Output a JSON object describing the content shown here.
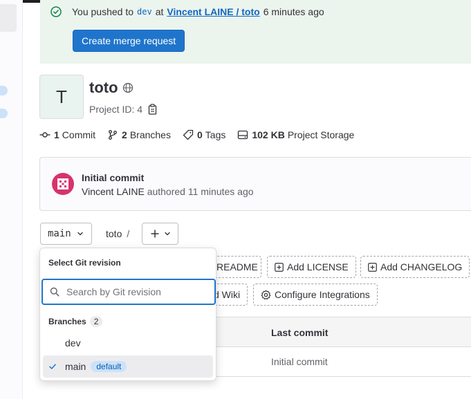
{
  "banner": {
    "text_before": "You pushed to",
    "branch": "dev",
    "text_at": "at",
    "project_link": "Vincent LAINE / toto",
    "time": "6 minutes ago",
    "button_label": "Create merge request"
  },
  "project": {
    "avatar_letter": "T",
    "name": "toto",
    "id_label": "Project ID: 4"
  },
  "stats": {
    "commits_count": "1",
    "commits_label": "Commit",
    "branches_count": "2",
    "branches_label": "Branches",
    "tags_count": "0",
    "tags_label": "Tags",
    "storage_size": "102 KB",
    "storage_label": "Project Storage"
  },
  "commit": {
    "title": "Initial commit",
    "author": "Vincent LAINE",
    "meta": "authored 11 minutes ago"
  },
  "repo_toolbar": {
    "ref": "main",
    "path": "toto",
    "separator": "/"
  },
  "quick_actions": {
    "readme": "README",
    "license": "Add LICENSE",
    "changelog": "Add CHANGELOG",
    "wiki": "d Wiki",
    "integrations": "Configure Integrations"
  },
  "table": {
    "last_commit_header": "Last commit",
    "row_last_commit": "Initial commit"
  },
  "revision_dropdown": {
    "header": "Select Git revision",
    "search_placeholder": "Search by Git revision",
    "section_label": "Branches",
    "section_count": "2",
    "items": [
      {
        "label": "dev",
        "selected": false
      },
      {
        "label": "main",
        "selected": true,
        "badge": "default"
      }
    ]
  },
  "colors": {
    "primary": "#1f75cb",
    "banner_bg": "#ecf4ee",
    "success": "#108548",
    "avatar_magenta": "#d6336c"
  }
}
